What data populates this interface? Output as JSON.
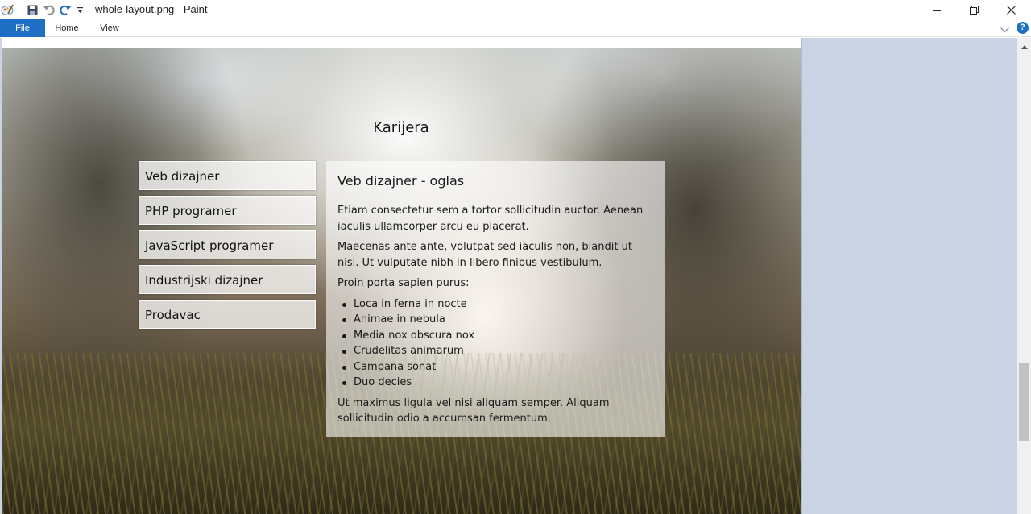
{
  "window": {
    "title": "whole-layout.png - Paint",
    "minimize_icon": "minimize-icon",
    "restore_icon": "restore-icon",
    "close_icon": "close-icon"
  },
  "quick_access": {
    "app_icon": "paint-app-icon",
    "save_icon": "save-icon",
    "undo_icon": "undo-icon",
    "redo_icon": "redo-icon",
    "customize_icon": "dropdown-arrow-icon"
  },
  "ribbon": {
    "tabs": [
      {
        "label": "File"
      },
      {
        "label": "Home"
      },
      {
        "label": "View"
      }
    ],
    "help_label": "?"
  },
  "image": {
    "heading": "Karijera",
    "menu": [
      {
        "label": "Veb dizajner"
      },
      {
        "label": "PHP programer"
      },
      {
        "label": "JavaScript programer"
      },
      {
        "label": "Industrijski dizajner"
      },
      {
        "label": "Prodavac"
      }
    ],
    "content": {
      "title": "Veb dizajner - oglas",
      "p1": "Etiam consectetur sem a tortor sollicitudin auctor. Aenean iaculis ullamcorper arcu eu placerat.",
      "p2": "Maecenas ante ante, volutpat sed iaculis non, blandit ut nisl. Ut vulputate nibh in libero finibus vestibulum.",
      "p3": "Proin porta sapien purus:",
      "list": [
        "Loca in ferna in nocte",
        "Animae in nebula",
        "Media nox obscura nox",
        "Crudelitas animarum",
        "Campana sonat",
        "Duo decies"
      ],
      "p4": "Ut maximus ligula vel nisi aliquam semper. Aliquam sollicitudin odio a accumsan fermentum."
    }
  },
  "colors": {
    "file_tab": "#1e6fc4",
    "workspace": "#c9d3e3"
  }
}
